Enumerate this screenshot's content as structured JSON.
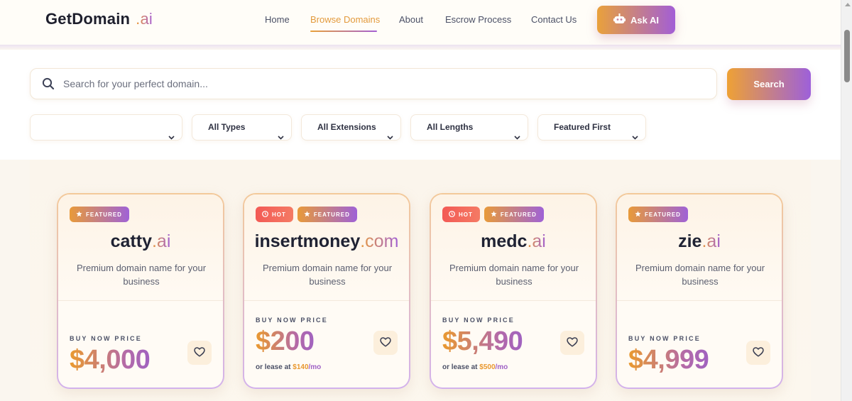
{
  "header": {
    "logo_main": "GetDomain",
    "logo_ext": ".ai",
    "nav": [
      {
        "label": "Home"
      },
      {
        "label": "Browse Domains",
        "active": true
      },
      {
        "label": "About"
      },
      {
        "label": "Escrow Process"
      },
      {
        "label": "Contact Us"
      }
    ],
    "ask_ai_label": "Ask AI"
  },
  "search": {
    "placeholder": "Search for your perfect domain...",
    "button_label": "Search"
  },
  "filters": [
    {
      "selected": ""
    },
    {
      "selected": "All Types"
    },
    {
      "selected": "All Extensions"
    },
    {
      "selected": "All Lengths"
    },
    {
      "selected": "Featured First"
    }
  ],
  "cards": [
    {
      "badges": [
        {
          "type": "featured",
          "label": "FEATURED"
        }
      ],
      "name": "catty",
      "ext": ".ai",
      "description": "Premium domain name for your business",
      "price_label": "BUY NOW PRICE",
      "price": "$4,000",
      "lease_prefix": "",
      "lease_amount": "",
      "lease_suffix": ""
    },
    {
      "badges": [
        {
          "type": "hot",
          "label": "HOT"
        },
        {
          "type": "featured",
          "label": "FEATURED"
        }
      ],
      "name": "insertmoney",
      "ext": ".com",
      "description": "Premium domain name for your business",
      "price_label": "BUY NOW PRICE",
      "price": "$200",
      "lease_prefix": "or lease at ",
      "lease_amount": "$140",
      "lease_suffix": "/mo"
    },
    {
      "badges": [
        {
          "type": "hot",
          "label": "HOT"
        },
        {
          "type": "featured",
          "label": "FEATURED"
        }
      ],
      "name": "medc",
      "ext": ".ai",
      "description": "Premium domain name for your business",
      "price_label": "BUY NOW PRICE",
      "price": "$5,490",
      "lease_prefix": "or lease at ",
      "lease_amount": "$500",
      "lease_suffix": "/mo"
    },
    {
      "badges": [
        {
          "type": "featured",
          "label": "FEATURED"
        }
      ],
      "name": "zie",
      "ext": ".ai",
      "description": "Premium domain name for your business",
      "price_label": "BUY NOW PRICE",
      "price": "$4,999",
      "lease_prefix": "",
      "lease_amount": "",
      "lease_suffix": ""
    }
  ],
  "colors": {
    "accent_orange": "#e9a13b",
    "accent_purple": "#a25ed6",
    "hot_red": "#f35a55",
    "page_bg": "#faf6ef"
  }
}
